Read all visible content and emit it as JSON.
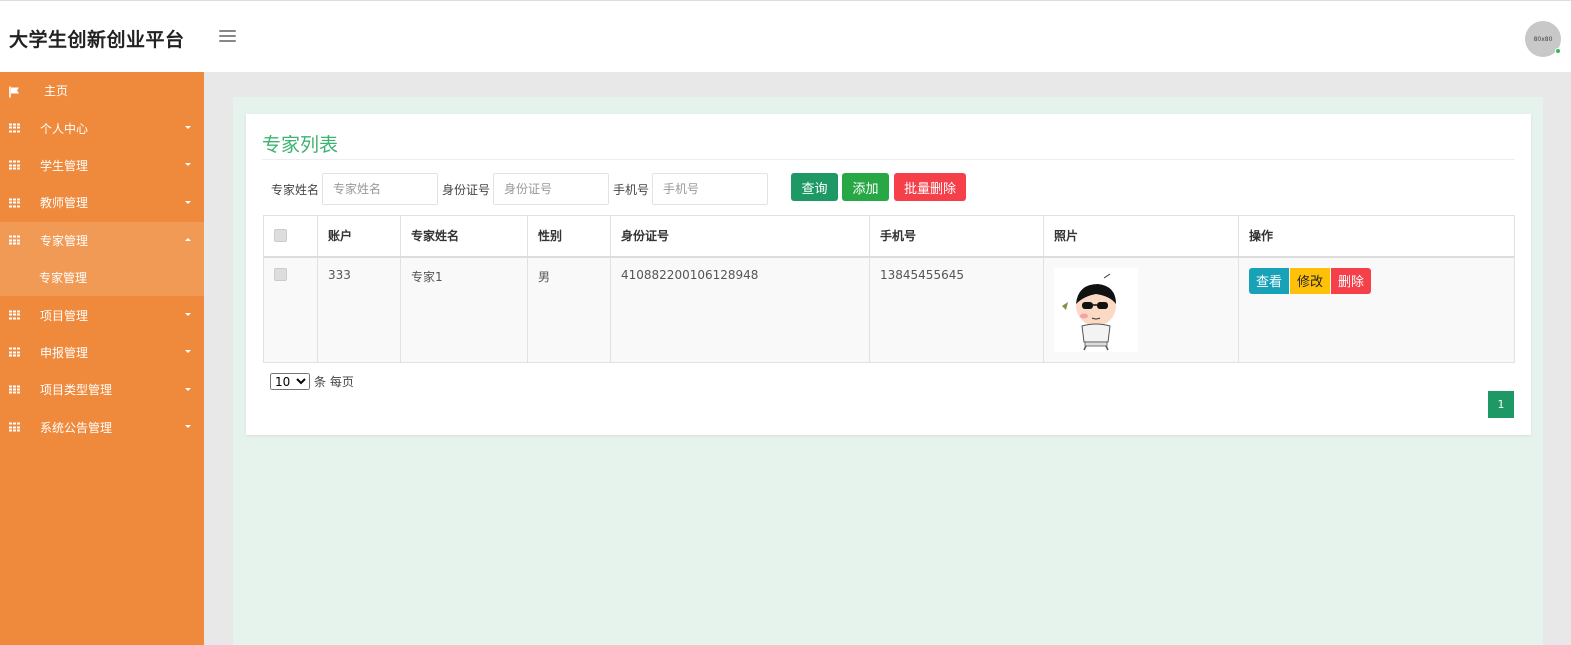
{
  "header": {
    "brand": "大学生创新创业平台",
    "avatar_text": "80x80"
  },
  "sidebar": {
    "items": [
      {
        "label": "主页",
        "icon": "flag-icon"
      },
      {
        "label": "个人中心",
        "icon": "grid-icon"
      },
      {
        "label": "学生管理",
        "icon": "grid-icon"
      },
      {
        "label": "教师管理",
        "icon": "grid-icon"
      },
      {
        "label": "专家管理",
        "icon": "grid-icon",
        "expanded": true
      },
      {
        "label": "专家管理",
        "sub": true
      },
      {
        "label": "项目管理",
        "icon": "grid-icon"
      },
      {
        "label": "申报管理",
        "icon": "grid-icon"
      },
      {
        "label": "项目类型管理",
        "icon": "grid-icon"
      },
      {
        "label": "系统公告管理",
        "icon": "grid-icon"
      }
    ]
  },
  "page": {
    "title": "专家列表"
  },
  "search": {
    "name_label": "专家姓名",
    "name_placeholder": "专家姓名",
    "id_label": "身份证号",
    "id_placeholder": "身份证号",
    "phone_label": "手机号",
    "phone_placeholder": "手机号",
    "query_label": "查询",
    "add_label": "添加",
    "batch_delete_label": "批量删除"
  },
  "table": {
    "columns": [
      "账户",
      "专家姓名",
      "性别",
      "身份证号",
      "手机号",
      "照片",
      "操作"
    ],
    "rows": [
      {
        "account": "333",
        "name": "专家1",
        "gender": "男",
        "id_number": "410882200106128948",
        "phone": "13845455645",
        "actions": {
          "view": "查看",
          "edit": "修改",
          "delete": "删除"
        }
      }
    ]
  },
  "pagination": {
    "page_size": "10",
    "per_page_text": "条 每页",
    "current_page": "1"
  },
  "colors": {
    "sidebar": "#ef8a3c",
    "title": "#3cb371",
    "primary": "#1e9966",
    "success": "#28a745",
    "danger": "#f5404a",
    "info": "#17a2b8",
    "warning": "#ffc107"
  }
}
